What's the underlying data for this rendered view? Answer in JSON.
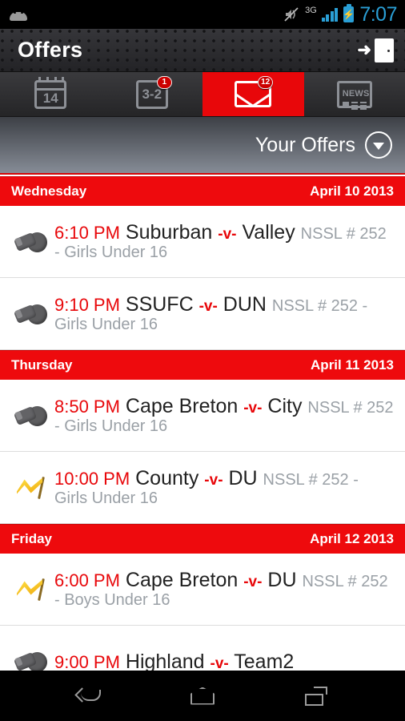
{
  "status_bar": {
    "notification_icon": "android-droid-icon",
    "vibrate_icon": "volume-mute-icon",
    "network_label": "3G",
    "signal_icon": "signal-bars-icon",
    "battery_icon": "battery-charging-icon",
    "time": "7:07"
  },
  "title_bar": {
    "title": "Offers",
    "exit_icon": "exit-door-icon"
  },
  "tabs": [
    {
      "name": "calendar",
      "icon": "calendar-icon",
      "day_number": "14",
      "badge": "",
      "active": false
    },
    {
      "name": "scores",
      "icon": "scores-icon",
      "label": "3-2",
      "badge": "1",
      "active": false
    },
    {
      "name": "offers",
      "icon": "mail-envelope-icon",
      "badge": "12",
      "active": true
    },
    {
      "name": "news",
      "icon": "news-icon",
      "label": "NEWS",
      "badge": "",
      "active": false
    }
  ],
  "filter_bar": {
    "label": "Your Offers",
    "dropdown_icon": "chevron-down-circle-icon"
  },
  "colors": {
    "accent_red": "#ee0a0d",
    "time_blue": "#2a9fd6",
    "subtitle_gray": "#9aa0a6"
  },
  "sections": [
    {
      "day": "Wednesday",
      "date": "April 10 2013",
      "games": [
        {
          "icon": "whistle-icon",
          "time": "6:10 PM",
          "home": "Suburban",
          "vs": "-v-",
          "away": "Valley",
          "details": "NSSL # 252 - Girls Under 16"
        },
        {
          "icon": "whistle-icon",
          "time": "9:10 PM",
          "home": "SSUFC",
          "vs": "-v-",
          "away": "DUN",
          "details": "NSSL # 252 - Girls Under 16"
        }
      ]
    },
    {
      "day": "Thursday",
      "date": "April 11 2013",
      "games": [
        {
          "icon": "whistle-icon",
          "time": "8:50 PM",
          "home": "Cape Breton",
          "vs": "-v-",
          "away": "City",
          "details": "NSSL # 252 - Girls Under 16"
        },
        {
          "icon": "flag-icon",
          "time": "10:00 PM",
          "home": "County",
          "vs": "-v-",
          "away": "DU",
          "details": "NSSL # 252 - Girls Under 16"
        }
      ]
    },
    {
      "day": "Friday",
      "date": "April 12 2013",
      "games": [
        {
          "icon": "flag-icon",
          "time": "6:00 PM",
          "home": "Cape Breton",
          "vs": "-v-",
          "away": "DU",
          "details": "NSSL # 252 - Boys Under 16"
        },
        {
          "icon": "whistle-icon",
          "time": "9:00 PM",
          "home": "Highland",
          "vs": "-v-",
          "away": "Team2",
          "details": ""
        }
      ]
    }
  ],
  "nav_bar": {
    "back_icon": "back-arrow-icon",
    "home_icon": "home-icon",
    "recents_icon": "recent-apps-icon"
  }
}
